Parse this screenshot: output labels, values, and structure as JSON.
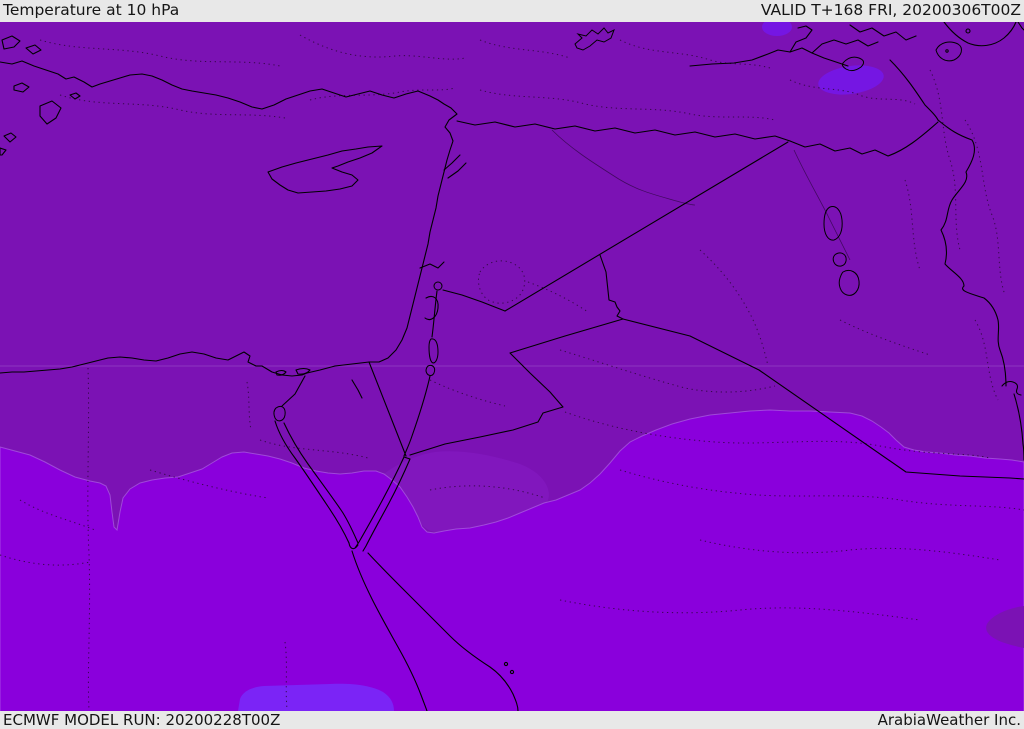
{
  "header": {
    "title": "Temperature at 10 hPa",
    "valid_time": "VALID T+168 FRI, 20200306T00Z"
  },
  "footer": {
    "model_run": "ECMWF MODEL RUN: 20200228T00Z",
    "credit": "ArabiaWeather Inc."
  },
  "map": {
    "palette": {
      "base": "#7B12B4",
      "mid_band": "#8117BD",
      "lower_band": "#8A00DC",
      "violet_pocket": "#7516E3",
      "violet_blob": "#7B24F6",
      "corner_patch": "#7B12B4",
      "gridline": "rgba(235,215,255,0.18)",
      "halo": "rgba(205,165,245,0.40)"
    },
    "bars_background": "#E8E8E8",
    "text_color": "#151515"
  }
}
